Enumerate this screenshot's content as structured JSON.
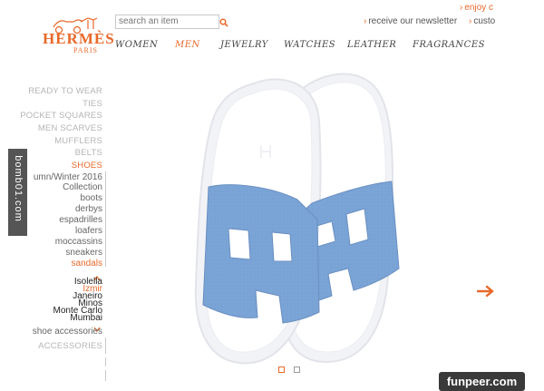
{
  "header": {
    "logo_text": "HERMÈS",
    "logo_sub": "PARIS",
    "search_placeholder": "search an item",
    "top_link_enjoy": "enjoy c",
    "top_link_newsletter": "receive our newsletter",
    "top_link_customer": "custo"
  },
  "nav": {
    "items": [
      {
        "label": "WOMEN"
      },
      {
        "label": "MEN"
      },
      {
        "label": "JEWELRY"
      },
      {
        "label": "WATCHES"
      },
      {
        "label": "LEATHER"
      },
      {
        "label": "FRAGRANCES"
      }
    ],
    "active": "MEN"
  },
  "sidebar": {
    "categories_top": [
      "READY TO WEAR",
      "TIES",
      "POCKET SQUARES",
      "MEN SCARVES",
      "MUFFLERS",
      "BELTS"
    ],
    "active_category": "SHOES",
    "subcategories": [
      "umn/Winter 2016",
      "Collection",
      "boots",
      "derbys",
      "espadrilles",
      "loafers",
      "moccassins",
      "sneakers"
    ],
    "active_subcategory": "sandals",
    "models": [
      "Isolella",
      "Izmir",
      "Janeiro",
      "Minos",
      "Monte Carlo",
      "Mumbai"
    ],
    "active_model": "Izmir",
    "shoe_accessories": "shoe accessories",
    "accessories": "ACCESSORIES"
  },
  "product": {
    "name": "Izmir",
    "strap_color": "#7aa3d6",
    "sole_color": "#f2f3f6",
    "image_count": 2,
    "active_image": 1
  },
  "watermark": "bomb01.com",
  "badge": "funpeer.com",
  "colors": {
    "accent": "#e8692a",
    "inactive_category": "#b5b5b5"
  }
}
